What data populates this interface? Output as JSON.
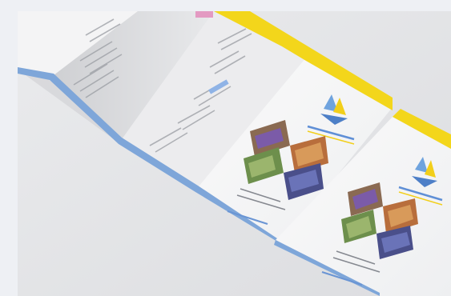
{
  "image": {
    "subject": "brochure-mockup",
    "palette": {
      "page_bg": "#eef0f4",
      "backdrop": "#e6e7e9",
      "paper": "#f6f6f7",
      "paper_shade": "#d9dadd",
      "yellow_band": "#f3d61b",
      "blue_edge": "#7ea6d9",
      "logo_blue": "#6fa3de",
      "logo_yellow": "#f2cf1a",
      "link_blue": "#6a95d4",
      "text_gray": "#6b6f78"
    }
  }
}
